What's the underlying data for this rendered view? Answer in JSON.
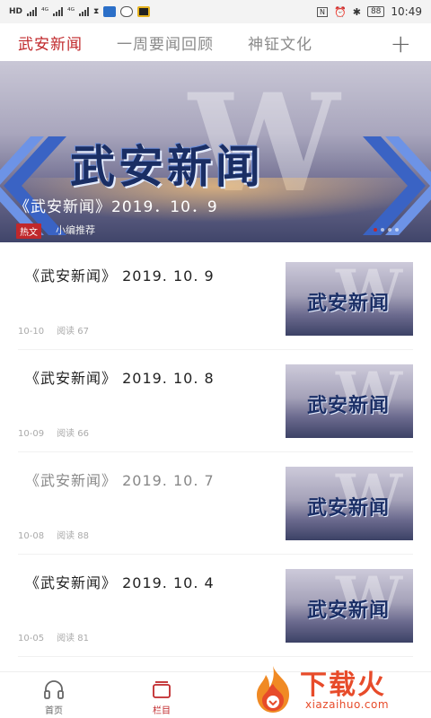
{
  "status_bar": {
    "left_tags": [
      "HD",
      "⁴ᴳ",
      "⁴ᴳ"
    ],
    "battery": "88",
    "time": "10:49"
  },
  "top_nav": {
    "tabs": [
      {
        "label": "武安新闻"
      },
      {
        "label": "一周要闻回顾"
      },
      {
        "label": "神钲文化"
      }
    ],
    "add_icon": "plus-icon",
    "accent_color": "#c0282b"
  },
  "banner": {
    "logo_text": "武安新闻",
    "logo_bg_text": "W",
    "caption": "《武安新闻》2019．10．9",
    "tag": "热文",
    "source": "小编推荐"
  },
  "news": [
    {
      "title": "《武安新闻》 2019. 10. 9",
      "date": "10-10",
      "reads": "阅读 67",
      "read": false
    },
    {
      "title": "《武安新闻》 2019. 10. 8",
      "date": "10-09",
      "reads": "阅读 66",
      "read": false
    },
    {
      "title": "《武安新闻》 2019. 10. 7",
      "date": "10-08",
      "reads": "阅读 88",
      "read": true
    },
    {
      "title": "《武安新闻》 2019. 10. 4",
      "date": "10-05",
      "reads": "阅读 81",
      "read": false
    }
  ],
  "thumb_text": "武安新闻",
  "bottom_tabs": [
    {
      "label": "首页",
      "icon": "headphones-icon"
    },
    {
      "label": "栏目",
      "icon": "column-icon"
    }
  ],
  "watermark": {
    "text": "下载火",
    "sub": "xiazaihuo.com"
  }
}
